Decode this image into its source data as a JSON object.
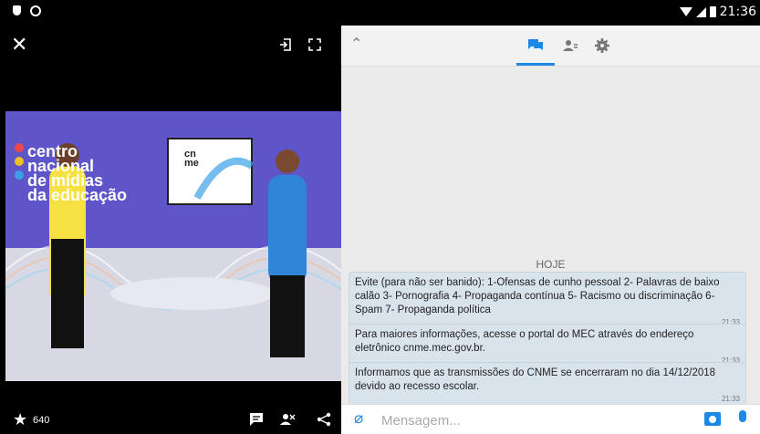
{
  "status_bar": {
    "time": "21:36"
  },
  "video": {
    "star_count": "640",
    "scene_text": [
      "centro",
      "nacional",
      "de mídias",
      "da educação"
    ],
    "screen_logo": [
      "cn",
      "me"
    ]
  },
  "chat": {
    "date_separator": "HOJE",
    "messages": [
      {
        "text": "Evite (para não ser banido): 1-Ofensas de cunho pessoal 2- Palavras de baixo calão 3- Pornografia 4- Propaganda contínua 5- Racismo ou discriminação 6- Spam 7- Propaganda política",
        "time": "21:33"
      },
      {
        "text": "Para maiores informações, acesse o portal do MEC através do endereço eletrônico cnme.mec.gov.br.",
        "time": "21:33"
      },
      {
        "text": "Informamos que as transmissões do CNME se encerraram no dia 14/12/2018 devido ao recesso escolar.",
        "time": "21:33"
      }
    ],
    "input_placeholder": "Mensagem..."
  },
  "colors": {
    "accent": "#1e88e5",
    "message_bg": "#d9e3ec",
    "studio_purple": "#5e56c8"
  },
  "icons": [
    "close-icon",
    "exit-icon",
    "fullscreen-icon",
    "star-icon",
    "chat-icon",
    "users-icon",
    "share-icon",
    "collapse-icon",
    "settings-icon",
    "attach-icon",
    "camera-icon",
    "mic-icon"
  ]
}
